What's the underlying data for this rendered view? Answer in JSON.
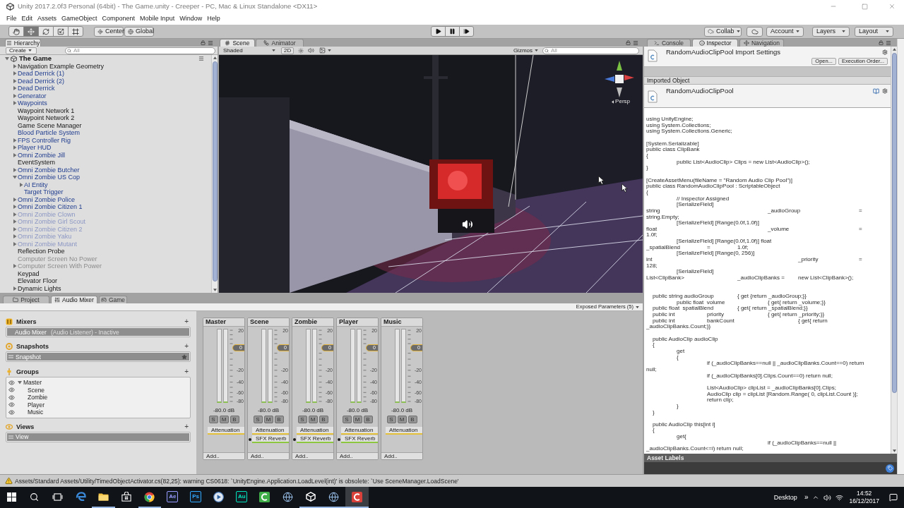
{
  "window": {
    "title": "Unity 2017.2.0f3 Personal (64bit) - The Game.unity - Creeper - PC, Mac & Linux Standalone <DX11>"
  },
  "menu": [
    "File",
    "Edit",
    "Assets",
    "GameObject",
    "Component",
    "Mobile Input",
    "Window",
    "Help"
  ],
  "toolbar": {
    "tools": [
      {
        "kind": "hand",
        "selected": false
      },
      {
        "kind": "move",
        "selected": true
      },
      {
        "kind": "rotate",
        "selected": false
      },
      {
        "kind": "scale",
        "selected": false
      },
      {
        "kind": "rect",
        "selected": false
      }
    ],
    "pivot": [
      {
        "kind": "pivot",
        "label": "Center"
      },
      {
        "kind": "globe",
        "label": "Global"
      }
    ],
    "playback": [
      {
        "kind": "play",
        "on": false
      },
      {
        "kind": "pause",
        "on": false
      },
      {
        "kind": "step",
        "on": false
      }
    ],
    "collab": "Collab",
    "account": "Account",
    "layers": "Layers",
    "layout": "Layout"
  },
  "hierarchy": {
    "tab": "Hierarchy",
    "create": "Create",
    "search_placeholder": "All",
    "scene": {
      "name": "The Game",
      "expanded": true
    },
    "items": [
      {
        "name": "Navigation Example Geometry",
        "prefab": false,
        "active": true,
        "expanded": false
      },
      {
        "name": "Dead Derrick (1)",
        "prefab": true,
        "active": true,
        "expanded": false
      },
      {
        "name": "Dead Derrick (2)",
        "prefab": true,
        "active": true,
        "expanded": false
      },
      {
        "name": "Dead Derrick",
        "prefab": true,
        "active": true,
        "expanded": false
      },
      {
        "name": "Generator",
        "prefab": true,
        "active": true,
        "expanded": false
      },
      {
        "name": "Waypoints",
        "prefab": true,
        "active": true,
        "expanded": false
      },
      {
        "name": "Waypoint Network 1",
        "prefab": false,
        "active": true
      },
      {
        "name": "Waypoint Network 2",
        "prefab": false,
        "active": true
      },
      {
        "name": "Game Scene Manager",
        "prefab": false,
        "active": true
      },
      {
        "name": "Blood Particle System",
        "prefab": true,
        "active": true
      },
      {
        "name": "FPS Controller Rig",
        "prefab": true,
        "active": true,
        "expanded": false
      },
      {
        "name": "Player HUD",
        "prefab": true,
        "active": true,
        "expanded": false
      },
      {
        "name": "Omni Zombie Jill",
        "prefab": true,
        "active": true,
        "expanded": false
      },
      {
        "name": "EventSystem",
        "prefab": false,
        "active": true
      },
      {
        "name": "Omni Zombie Butcher",
        "prefab": true,
        "active": true,
        "expanded": false
      },
      {
        "name": "Omni Zombie US Cop",
        "prefab": true,
        "active": true,
        "expanded": true,
        "children": [
          {
            "name": "AI Entity",
            "prefab": true,
            "active": true,
            "expanded": false
          },
          {
            "name": "Target Trigger",
            "prefab": true,
            "active": true
          }
        ]
      },
      {
        "name": "Omni Zombie Police",
        "prefab": true,
        "active": true,
        "expanded": false
      },
      {
        "name": "Omni Zombie Citizen 1",
        "prefab": true,
        "active": true,
        "expanded": false
      },
      {
        "name": "Omni Zombie Clown",
        "prefab": true,
        "active": false,
        "expanded": false
      },
      {
        "name": "Omni Zombie Girl Scout",
        "prefab": true,
        "active": false,
        "expanded": false
      },
      {
        "name": "Omni Zombie Citizen 2",
        "prefab": true,
        "active": false,
        "expanded": false
      },
      {
        "name": "Omni Zombie Yaku",
        "prefab": true,
        "active": false,
        "expanded": false
      },
      {
        "name": "Omni Zombie Mutant",
        "prefab": true,
        "active": false,
        "expanded": false
      },
      {
        "name": "Reflection Probe",
        "prefab": false,
        "active": true
      },
      {
        "name": "Computer Screen No Power",
        "prefab": false,
        "active": false
      },
      {
        "name": "Computer Screen With Power",
        "prefab": false,
        "active": false,
        "expanded": false
      },
      {
        "name": "Keypad",
        "prefab": false,
        "active": true
      },
      {
        "name": "Elevator Floor",
        "prefab": false,
        "active": true
      },
      {
        "name": "Dynamic Lights",
        "prefab": false,
        "active": true,
        "expanded": false
      }
    ]
  },
  "scene_view": {
    "tabs": [
      {
        "label": "Scene",
        "kind": "scene",
        "selected": true
      },
      {
        "label": "Animator",
        "kind": "animator",
        "selected": false
      }
    ],
    "shading": "Shaded",
    "mode_2d": {
      "label": "2D",
      "on": false
    },
    "gizmos": "Gizmos",
    "search_placeholder": "All",
    "projection": "Persp"
  },
  "inspector": {
    "tabs": [
      {
        "label": "Console",
        "kind": "console",
        "selected": false
      },
      {
        "label": "Inspector",
        "kind": "info",
        "selected": true
      },
      {
        "label": "Navigation",
        "kind": "navigation",
        "selected": false
      }
    ],
    "title": "RandomAudioClipPool Import Settings",
    "buttons": [
      "Open...",
      "Execution Order..."
    ],
    "section": "Imported Object",
    "asset_name": "RandomAudioClipPool",
    "code": "using UnityEngine;\nusing System.Collections;\nusing System.Collections.Generic;\n\n[System.Serializable]\npublic class ClipBank\n{\n\tpublic List<AudioClip> Clips = new List<AudioClip>();\n}\n\n[CreateAssetMenu(fileName = \"Random Audio Clip Pool\")]\npublic class RandomAudioClipPool : ScriptableObject\n{\n\t// Inspector Assigned\n\t[SerializeField]\nstring\t\t\t\t_audioGroup\t\t=\nstring.Empty;\n\t[SerializeField] [Range(0.0f,1.0f)]\nfloat\t\t\t\t_volume\t\t\t=\n1.0f;\n\t[SerializeField] [Range(0.0f,1.0f)] float\n_spatialBlend\t=\t1.0f;\n\t[SerializeField] [Range(0, 256)]\nint\t\t\t\t\t_priority\t\t=\n128;\n\t[SerializeField]\nList<ClipBank>\t\t_audioClipBanks =\tnew List<ClipBank>();\n\n\n    public string audioGroup\t{ get {return _audioGroup;}}\n\tpublic float  volume\t\t{ get{ return _volume;}}\n    public float  spatialBlend\t{ get{ return _spatialBlend;}}\n    public int\t\tpriority\t\t{ get{ return _priority;}}\n    public int\t\tbankCount\t\t\t{ get{ return\n_audioClipBanks.Count;}}\n\n    public AudioClip audioClip\n    {\n\tget\n\t{\n\t\tif (_audioClipBanks==null || _audioClipBanks.Count==0) return\nnull;\n\t\tif (_audioClipBanks[0].Clips.Count==0) return null;\n\n\t\tList<AudioClip> clipList = _audioClipBanks[0].Clips;\n\t\tAudioClip clip = clipList [Random.Range( 0, clipList.Count )];\n\t\treturn clip;\n\t}\n    }\n\n    public AudioClip this[int i]\n    {\n\tget{\n\t\t\t\tif (_audioClipBanks==null ||\n_audioClipBanks.Count<=i) return null;",
    "labels_heading": "Asset Labels"
  },
  "bottom_panel": {
    "tabs": [
      {
        "label": "Project",
        "kind": "project",
        "selected": false
      },
      {
        "label": "Audio Mixer",
        "kind": "mixer",
        "selected": true
      },
      {
        "label": "Game",
        "kind": "game",
        "selected": false
      }
    ],
    "exposed_parameters": "Exposed Parameters (5)",
    "mixers": {
      "title": "Mixers",
      "add": "+",
      "items": [
        {
          "name": "Audio Mixer",
          "detail": "(Audio Listener) - Inactive",
          "selected": true
        }
      ]
    },
    "snapshots": {
      "title": "Snapshots",
      "add": "+",
      "items": [
        {
          "name": "Snapshot",
          "selected": true,
          "starred": true
        }
      ]
    },
    "groups": {
      "title": "Groups",
      "add": "+",
      "tree": [
        {
          "name": "Master",
          "visible": true,
          "expanded": true,
          "children": [
            {
              "name": "Scene",
              "visible": true
            },
            {
              "name": "Zombie",
              "visible": true
            },
            {
              "name": "Player",
              "visible": true
            },
            {
              "name": "Music",
              "visible": true
            }
          ]
        }
      ]
    },
    "views": {
      "title": "Views",
      "add": "+",
      "items": [
        {
          "name": "View",
          "selected": true
        }
      ]
    },
    "channels": [
      {
        "name": "Master",
        "scale": [
          "20",
          "-20",
          "-40",
          "-60",
          "-80"
        ],
        "fader": {
          "label": "0",
          "level": 0.74
        },
        "reading": "-80.0 dB",
        "buttons": [
          {
            "label": "S",
            "on": false
          },
          {
            "label": "M",
            "on": false
          },
          {
            "label": "B",
            "on": false
          }
        ],
        "effects": [
          {
            "kind": "attenuation",
            "name": "Attenuation"
          }
        ],
        "add": "Add.."
      },
      {
        "name": "Scene",
        "scale": [
          "20",
          "-20",
          "-40",
          "-60",
          "-80"
        ],
        "fader": {
          "label": "0",
          "level": 0.74
        },
        "reading": "-80.0 dB",
        "buttons": [
          {
            "label": "S",
            "on": false
          },
          {
            "label": "M",
            "on": false
          },
          {
            "label": "B",
            "on": false
          }
        ],
        "effects": [
          {
            "kind": "attenuation",
            "name": "Attenuation"
          },
          {
            "kind": "send",
            "name": "SFX Reverb"
          }
        ],
        "add": "Add.."
      },
      {
        "name": "Zombie",
        "scale": [
          "20",
          "-20",
          "-40",
          "-60",
          "-80"
        ],
        "fader": {
          "label": "0",
          "level": 0.74
        },
        "reading": "-80.0 dB",
        "buttons": [
          {
            "label": "S",
            "on": false
          },
          {
            "label": "M",
            "on": false
          },
          {
            "label": "B",
            "on": false
          }
        ],
        "effects": [
          {
            "kind": "attenuation",
            "name": "Attenuation"
          },
          {
            "kind": "send",
            "name": "SFX Reverb"
          }
        ],
        "add": "Add.."
      },
      {
        "name": "Player",
        "scale": [
          "20",
          "-20",
          "-40",
          "-60",
          "-80"
        ],
        "fader": {
          "label": "0",
          "level": 0.74
        },
        "reading": "-80.0 dB",
        "buttons": [
          {
            "label": "S",
            "on": false
          },
          {
            "label": "M",
            "on": false
          },
          {
            "label": "B",
            "on": false
          }
        ],
        "effects": [
          {
            "kind": "attenuation",
            "name": "Attenuation"
          },
          {
            "kind": "send",
            "name": "SFX Reverb"
          }
        ],
        "add": "Add.."
      },
      {
        "name": "Music",
        "scale": [
          "20",
          "-20",
          "-40",
          "-60",
          "-80"
        ],
        "fader": {
          "label": "0",
          "level": 0.74
        },
        "reading": "-80.0 dB",
        "buttons": [
          {
            "label": "S",
            "on": false
          },
          {
            "label": "M",
            "on": false
          },
          {
            "label": "B",
            "on": false
          }
        ],
        "effects": [
          {
            "kind": "attenuation",
            "name": "Attenuation"
          }
        ],
        "add": "Add.."
      }
    ]
  },
  "status_bar": {
    "message": "Assets/Standard Assets/Utility/TimedObjectActivator.cs(82,25): warning CS0618: `UnityEngine.Application.LoadLevel(int)' is obsolete: `Use SceneManager.LoadScene'"
  },
  "taskbar": {
    "apps": [
      {
        "kind": "start"
      },
      {
        "kind": "search"
      },
      {
        "kind": "taskview"
      },
      {
        "kind": "edge",
        "running": false,
        "selected": false
      },
      {
        "kind": "folder",
        "running": true,
        "selected": false
      },
      {
        "kind": "store",
        "running": false,
        "selected": false
      },
      {
        "kind": "chrome",
        "running": true,
        "selected": false
      },
      {
        "kind": "tile",
        "label": "Ae",
        "color": "#9999ff",
        "running": false,
        "selected": false
      },
      {
        "kind": "tile",
        "label": "Ps",
        "color": "#31a8ff",
        "running": false,
        "selected": false
      },
      {
        "kind": "media",
        "running": false,
        "selected": false
      },
      {
        "kind": "tile",
        "label": "Au",
        "color": "#00e4bb",
        "running": false,
        "selected": false
      },
      {
        "kind": "arc",
        "color": "#3fae49",
        "running": false,
        "selected": false
      },
      {
        "kind": "globe",
        "running": false,
        "selected": false
      },
      {
        "kind": "unity",
        "running": true,
        "selected": false
      },
      {
        "kind": "globe",
        "running": true,
        "selected": false
      },
      {
        "kind": "arc",
        "color": "#d9413a",
        "running": true,
        "selected": true
      }
    ],
    "desktop": "Desktop",
    "more": "»",
    "time": "14:52",
    "date": "16/12/2017"
  }
}
